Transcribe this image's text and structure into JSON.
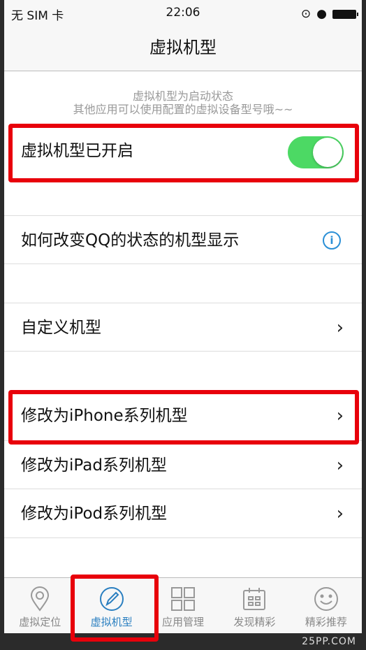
{
  "status": {
    "carrier": "无 SIM 卡",
    "time": "22:06"
  },
  "nav": {
    "title": "虚拟机型"
  },
  "notice": {
    "line1": "虚拟机型为启动状态",
    "line2": "其他应用可以使用配置的虚拟设备型号哦~~"
  },
  "toggle_row": {
    "label": "虚拟机型已开启",
    "on": true
  },
  "rows": [
    {
      "label": "如何改变QQ的状态的机型显示",
      "icon": "info-icon"
    },
    {
      "label": "自定义机型",
      "icon": "chevron-right-icon"
    },
    {
      "label": "修改为iPhone系列机型",
      "icon": "chevron-right-icon"
    },
    {
      "label": "修改为iPad系列机型",
      "icon": "chevron-right-icon"
    },
    {
      "label": "修改为iPod系列机型",
      "icon": "chevron-right-icon"
    }
  ],
  "tabs": [
    {
      "label": "虚拟定位",
      "icon": "location-pin-icon"
    },
    {
      "label": "虚拟机型",
      "icon": "pencil-circle-icon",
      "active": true
    },
    {
      "label": "应用管理",
      "icon": "grid-icon"
    },
    {
      "label": "发现精彩",
      "icon": "calendar-icon"
    },
    {
      "label": "精彩推荐",
      "icon": "smiley-icon"
    }
  ],
  "watermark": "25PP.COM",
  "colors": {
    "accent": "#2a7fc0",
    "toggle": "#4cd964",
    "highlight": "#e8000b"
  }
}
